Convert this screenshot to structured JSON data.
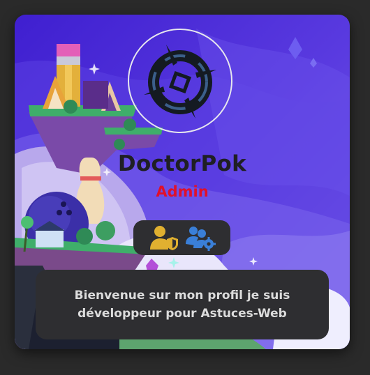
{
  "profile": {
    "username": "DoctorPok",
    "role": "Admin",
    "role_color": "#e0102a",
    "avatar_icon": "doctorpok-logo-icon",
    "badges": [
      {
        "icon": "user-shield-icon",
        "color": "#e0b030"
      },
      {
        "icon": "users-gear-icon",
        "color": "#3a7fd8"
      }
    ],
    "bio": "Bienvenue sur mon profil je suis développeur pour Astuces-Web"
  },
  "colors": {
    "page_background": "#2a2a2a",
    "banner_purple": "#4a2ed6",
    "panel": "#2e2e31"
  }
}
